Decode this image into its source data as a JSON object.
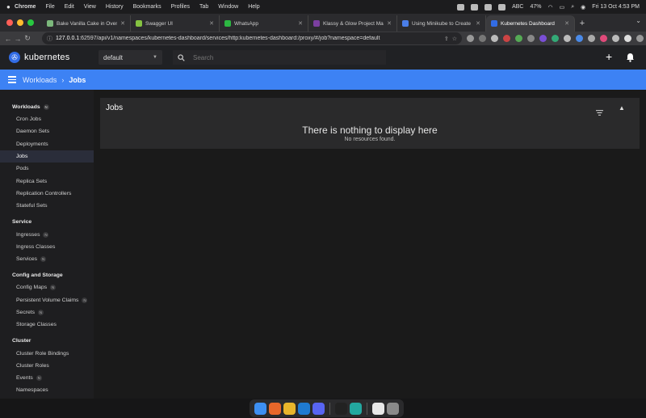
{
  "menubar": {
    "app": "Chrome",
    "items": [
      "File",
      "Edit",
      "View",
      "History",
      "Bookmarks",
      "Profiles",
      "Tab",
      "Window",
      "Help"
    ],
    "abc": "ABC",
    "battery": "47%",
    "clock": "Fri 13 Oct  4:53 PM"
  },
  "tabs": [
    {
      "label": "Bake Vanilla Cake in Oven",
      "color": "#7cb87c"
    },
    {
      "label": "Swagger UI",
      "color": "#85c341"
    },
    {
      "label": "WhatsApp",
      "color": "#2cb742"
    },
    {
      "label": "Klassy & Glow Project Manag",
      "color": "#7b3fa0"
    },
    {
      "label": "Using Minikube to Create a Cl",
      "color": "#4a7ee8"
    },
    {
      "label": "Kubernetes Dashboard",
      "color": "#326ce5"
    }
  ],
  "address": {
    "host": "127.0.0.1",
    "path": ":62597/api/v1/namespaces/kubernetes-dashboard/services/http:kubernetes-dashboard:/proxy/#/job?namespace=default"
  },
  "header": {
    "logo_text": "kubernetes",
    "namespace": "default",
    "search_placeholder": "Search"
  },
  "breadcrumb": {
    "parent": "Workloads",
    "current": "Jobs"
  },
  "sidebar": {
    "sections": [
      {
        "title": "Workloads",
        "badge": "N",
        "items": [
          {
            "label": "Cron Jobs"
          },
          {
            "label": "Daemon Sets"
          },
          {
            "label": "Deployments"
          },
          {
            "label": "Jobs"
          },
          {
            "label": "Pods"
          },
          {
            "label": "Replica Sets"
          },
          {
            "label": "Replication Controllers"
          },
          {
            "label": "Stateful Sets"
          }
        ]
      },
      {
        "title": "Service",
        "items": [
          {
            "label": "Ingresses",
            "badge": "N"
          },
          {
            "label": "Ingress Classes"
          },
          {
            "label": "Services",
            "badge": "N"
          }
        ]
      },
      {
        "title": "Config and Storage",
        "items": [
          {
            "label": "Config Maps",
            "badge": "N"
          },
          {
            "label": "Persistent Volume Claims",
            "badge": "N"
          },
          {
            "label": "Secrets",
            "badge": "N"
          },
          {
            "label": "Storage Classes"
          }
        ]
      },
      {
        "title": "Cluster",
        "items": [
          {
            "label": "Cluster Role Bindings"
          },
          {
            "label": "Cluster Roles"
          },
          {
            "label": "Events",
            "badge": "N"
          },
          {
            "label": "Namespaces"
          }
        ]
      }
    ]
  },
  "main": {
    "card_title": "Jobs",
    "empty_title": "There is nothing to display here",
    "empty_subtitle": "No resources found."
  },
  "dock": {
    "icons": [
      {
        "name": "finder-icon",
        "color": "#3d8ff2"
      },
      {
        "name": "firefox-icon",
        "color": "#e8672a"
      },
      {
        "name": "chrome-icon",
        "color": "#e9b52b"
      },
      {
        "name": "vscode-icon",
        "color": "#1f7ad1"
      },
      {
        "name": "discord-icon",
        "color": "#5865f2"
      },
      {
        "name": "terminal-icon",
        "color": "#222222"
      },
      {
        "name": "vscode-insiders-icon",
        "color": "#23a8a0"
      },
      {
        "name": "notes-icon",
        "color": "#e8e8e8"
      },
      {
        "name": "trash-icon",
        "color": "#8a8a8a"
      }
    ]
  }
}
